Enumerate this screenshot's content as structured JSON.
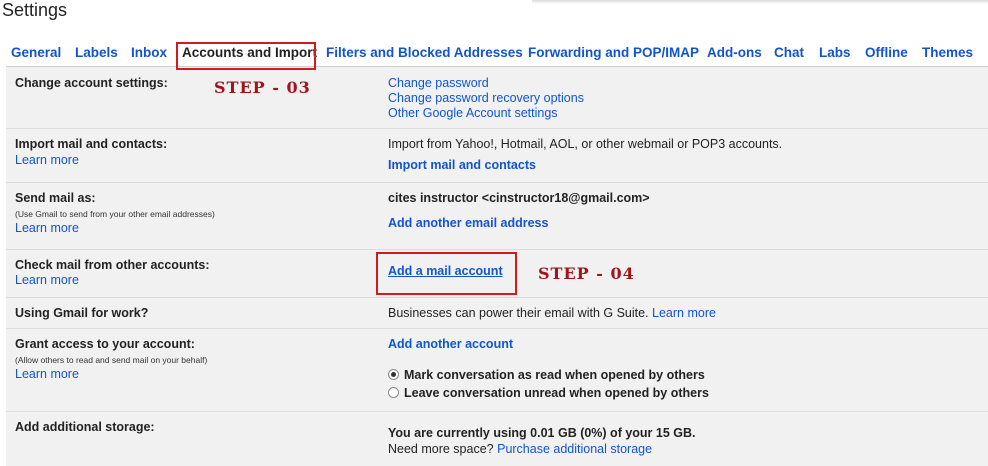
{
  "header": {
    "title": "Settings"
  },
  "tabs": [
    {
      "label": "General"
    },
    {
      "label": "Labels"
    },
    {
      "label": "Inbox"
    },
    {
      "label": "Accounts and Import",
      "active": true
    },
    {
      "label": "Filters and Blocked Addresses"
    },
    {
      "label": "Forwarding and POP/IMAP"
    },
    {
      "label": "Add-ons"
    },
    {
      "label": "Chat"
    },
    {
      "label": "Labs"
    },
    {
      "label": "Offline"
    },
    {
      "label": "Themes"
    }
  ],
  "annotations": {
    "step3": "STEP - 03",
    "step4": "STEP - 04",
    "box_color": "#d21b21",
    "text_color": "#a0141b"
  },
  "rows": {
    "change_account": {
      "label": "Change account settings:",
      "links": [
        "Change password",
        "Change password recovery options",
        "Other Google Account settings"
      ]
    },
    "import_mail": {
      "label": "Import mail and contacts:",
      "learn_more": "Learn more",
      "description": "Import from Yahoo!, Hotmail, AOL, or other webmail or POP3 accounts.",
      "action": "Import mail and contacts"
    },
    "send_mail": {
      "label": "Send mail as:",
      "sub": "(Use Gmail to send from your other email addresses)",
      "learn_more": "Learn more",
      "account": "cites instructor <cinstructor18@gmail.com>",
      "action": "Add another email address"
    },
    "check_mail": {
      "label": "Check mail from other accounts:",
      "learn_more": "Learn more",
      "action": "Add a mail account"
    },
    "gmail_work": {
      "label": "Using Gmail for work?",
      "description": "Businesses can power their email with G Suite.",
      "learn_more": "Learn more"
    },
    "grant_access": {
      "label": "Grant access to your account:",
      "sub": "(Allow others to read and send mail on your behalf)",
      "learn_more": "Learn more",
      "action": "Add another account",
      "option_read": "Mark conversation as read when opened by others",
      "option_unread": "Leave conversation unread when opened by others",
      "selected": "read"
    },
    "storage": {
      "label": "Add additional storage:",
      "usage": "You are currently using 0.01 GB (0%) of your 15 GB.",
      "need_more": "Need more space?",
      "purchase": "Purchase additional storage"
    }
  }
}
